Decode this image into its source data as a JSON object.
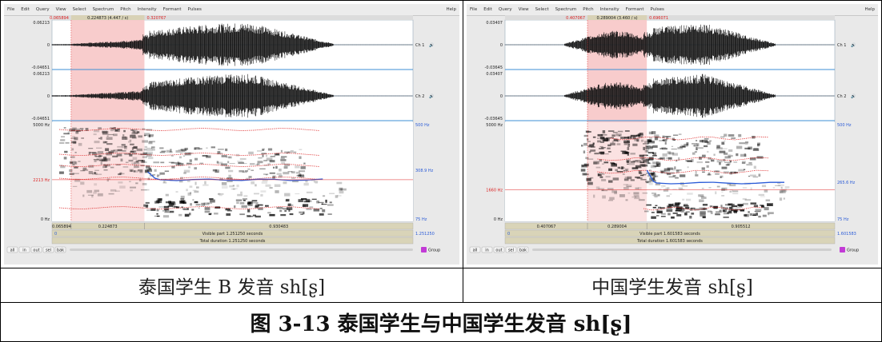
{
  "menu_items": [
    "File",
    "Edit",
    "Query",
    "View",
    "Select",
    "Spectrum",
    "Pitch",
    "Intensity",
    "Formant",
    "Pulses"
  ],
  "help_label": "Help",
  "channel_labels": [
    "Ch 1",
    "Ch 2"
  ],
  "bottom_buttons": [
    "all",
    "in",
    "out",
    "sel",
    "bak"
  ],
  "group_label": "Group",
  "left_panel": {
    "sel_start": "0.065894",
    "sel_len": "0.224873 (4.447 / s)",
    "sel_end": "0.320767",
    "amp_top": "0.06213",
    "amp_bottom": "-0.04651",
    "zero": "0",
    "freq_top": "5000 Hz",
    "freq_bottom": "0 Hz",
    "cursor_freq": "2213 Hz",
    "right_top_hz": "500 Hz",
    "right_mid_hz": "308.9 Hz",
    "right_bottom_hz": "75 Hz",
    "bar_a": "0.065894",
    "bar_b": "0.224873",
    "bar_c": "0.930483",
    "visible_left": "0",
    "visible_text": "Visible part 1.251250 seconds",
    "visible_right": "1.251250",
    "total_text": "Total duration 1.251250 seconds"
  },
  "right_panel": {
    "sel_start": "0.407067",
    "sel_len": "0.289004 (3.460 / s)",
    "sel_end": "0.696071",
    "amp_top": "0.03407",
    "amp_bottom": "-0.03645",
    "zero": "0",
    "freq_top": "5000 Hz",
    "freq_bottom": "0 Hz",
    "cursor_freq": "1660 Hz",
    "right_top_hz": "500 Hz",
    "right_mid_hz": "265.6 Hz",
    "right_bottom_hz": "75 Hz",
    "bar_a": "0.407067",
    "bar_b": "0.289004",
    "bar_c": "0.905512",
    "visible_left": "0",
    "visible_text": "Visible part 1.601583 seconds",
    "visible_right": "1.601583",
    "total_text": "Total duration 1.601583 seconds"
  },
  "captions": {
    "left": "泰国学生 B 发音 sh[ʂ]",
    "right": "中国学生发音 sh[ʂ]",
    "figure": "图 3-13 泰国学生与中国学生发音 sh[ʂ]"
  },
  "colors": {
    "selection": "#f7c6c6",
    "accent_red": "#d22",
    "pitch_blue": "#2a5bd7",
    "channel_blue": "#3d8fd6"
  }
}
